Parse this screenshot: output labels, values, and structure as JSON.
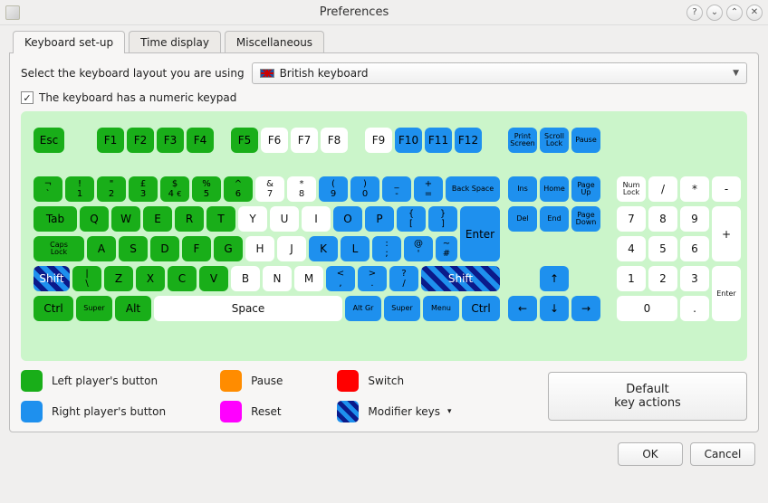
{
  "window": {
    "title": "Preferences",
    "help": "?",
    "min": "⌄",
    "max": "⌃",
    "close": "✕"
  },
  "tabs": {
    "keyboard": "Keyboard set-up",
    "time": "Time display",
    "misc": "Miscellaneous"
  },
  "layout": {
    "prompt": "Select the keyboard layout you are using",
    "value": "British keyboard"
  },
  "numpad": {
    "label": "The keyboard has a numeric keypad",
    "checked": "✓"
  },
  "keys": {
    "esc": "Esc",
    "f1": "F1",
    "f2": "F2",
    "f3": "F3",
    "f4": "F4",
    "f5": "F5",
    "f6": "F6",
    "f7": "F7",
    "f8": "F8",
    "f9": "F9",
    "f10": "F10",
    "f11": "F11",
    "f12": "F12",
    "prtsc": "Print\nScreen",
    "scrlk": "Scroll\nLock",
    "pause": "Pause",
    "row1": {
      "k0t": "¬",
      "k0b": "`",
      "k1t": "!",
      "k1b": "1",
      "k2t": "\"",
      "k2b": "2",
      "k3t": "£",
      "k3b": "3",
      "k4t": "$",
      "k4b": "4",
      "k4e": "€",
      "k5t": "%",
      "k5b": "5",
      "k6t": "^",
      "k6b": "6",
      "k7t": "&",
      "k7b": "7",
      "k8t": "*",
      "k8b": "8",
      "k9t": "(",
      "k9b": "9",
      "k10t": ")",
      "k10b": "0",
      "k11t": "_",
      "k11b": "-",
      "k12t": "+",
      "k12b": "=",
      "back": "Back Space"
    },
    "row2": {
      "tab": "Tab",
      "q": "Q",
      "w": "W",
      "e": "E",
      "r": "R",
      "t": "T",
      "y": "Y",
      "u": "U",
      "i": "I",
      "o": "O",
      "p": "P",
      "lb_t": "{",
      "lb_b": "[",
      "rb_t": "}",
      "rb_b": "]",
      "enter": "Enter"
    },
    "row3": {
      "caps": "Caps\nLock",
      "a": "A",
      "s": "S",
      "d": "D",
      "f": "F",
      "g": "G",
      "h": "H",
      "j": "J",
      "k": "K",
      "l": "L",
      "sc_t": ":",
      "sc_b": ";",
      "ap_t": "@",
      "ap_b": "'",
      "hs_t": "~",
      "hs_b": "#"
    },
    "row4": {
      "lshift": "Shift",
      "bs_t": "|",
      "bs_b": "\\",
      "z": "Z",
      "x": "X",
      "c": "C",
      "v": "V",
      "b": "B",
      "n": "N",
      "m": "M",
      "cm_t": "<",
      "cm_b": ",",
      "pd_t": ">",
      "pd_b": ".",
      "sl_t": "?",
      "sl_b": "/",
      "rshift": "Shift"
    },
    "row5": {
      "lctrl": "Ctrl",
      "lsuper": "Super",
      "lalt": "Alt",
      "space": "Space",
      "altgr": "Alt Gr",
      "rsuper": "Super",
      "menu": "Menu",
      "rctrl": "Ctrl"
    },
    "nav": {
      "ins": "Ins",
      "home": "Home",
      "pgup": "Page\nUp",
      "del": "Del",
      "end": "End",
      "pgdn": "Page\nDown",
      "up": "↑",
      "left": "←",
      "down": "↓",
      "right": "→"
    },
    "np": {
      "numlk": "Num\nLock",
      "div": "/",
      "mul": "*",
      "sub": "-",
      "7": "7",
      "8": "8",
      "9": "9",
      "add": "+",
      "4": "4",
      "5": "5",
      "6": "6",
      "1": "1",
      "2": "2",
      "3": "3",
      "enter": "Enter",
      "0": "0",
      "dot": "."
    }
  },
  "legend": {
    "left": "Left player's button",
    "right": "Right player's button",
    "pause": "Pause",
    "reset": "Reset",
    "switch": "Switch",
    "mod": "Modifier keys"
  },
  "buttons": {
    "defaults": "Default\nkey actions",
    "ok": "OK",
    "cancel": "Cancel"
  }
}
